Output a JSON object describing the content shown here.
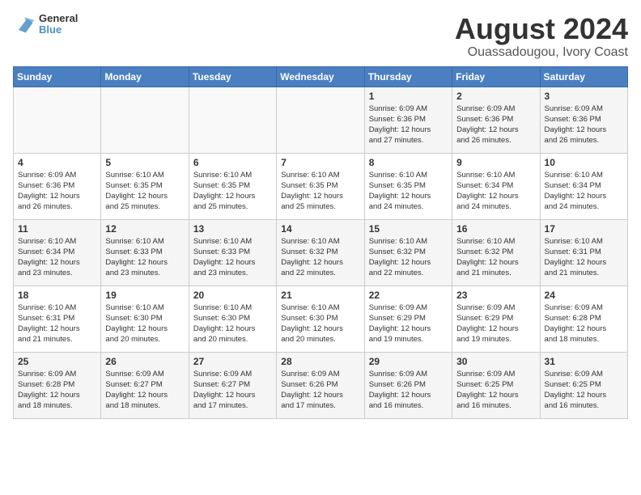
{
  "header": {
    "logo_line1": "General",
    "logo_line2": "Blue",
    "month_title": "August 2024",
    "subtitle": "Ouassadougou, Ivory Coast"
  },
  "weekdays": [
    "Sunday",
    "Monday",
    "Tuesday",
    "Wednesday",
    "Thursday",
    "Friday",
    "Saturday"
  ],
  "weeks": [
    [
      {
        "day": "",
        "text": ""
      },
      {
        "day": "",
        "text": ""
      },
      {
        "day": "",
        "text": ""
      },
      {
        "day": "",
        "text": ""
      },
      {
        "day": "1",
        "text": "Sunrise: 6:09 AM\nSunset: 6:36 PM\nDaylight: 12 hours\nand 27 minutes."
      },
      {
        "day": "2",
        "text": "Sunrise: 6:09 AM\nSunset: 6:36 PM\nDaylight: 12 hours\nand 26 minutes."
      },
      {
        "day": "3",
        "text": "Sunrise: 6:09 AM\nSunset: 6:36 PM\nDaylight: 12 hours\nand 26 minutes."
      }
    ],
    [
      {
        "day": "4",
        "text": "Sunrise: 6:09 AM\nSunset: 6:36 PM\nDaylight: 12 hours\nand 26 minutes."
      },
      {
        "day": "5",
        "text": "Sunrise: 6:10 AM\nSunset: 6:35 PM\nDaylight: 12 hours\nand 25 minutes."
      },
      {
        "day": "6",
        "text": "Sunrise: 6:10 AM\nSunset: 6:35 PM\nDaylight: 12 hours\nand 25 minutes."
      },
      {
        "day": "7",
        "text": "Sunrise: 6:10 AM\nSunset: 6:35 PM\nDaylight: 12 hours\nand 25 minutes."
      },
      {
        "day": "8",
        "text": "Sunrise: 6:10 AM\nSunset: 6:35 PM\nDaylight: 12 hours\nand 24 minutes."
      },
      {
        "day": "9",
        "text": "Sunrise: 6:10 AM\nSunset: 6:34 PM\nDaylight: 12 hours\nand 24 minutes."
      },
      {
        "day": "10",
        "text": "Sunrise: 6:10 AM\nSunset: 6:34 PM\nDaylight: 12 hours\nand 24 minutes."
      }
    ],
    [
      {
        "day": "11",
        "text": "Sunrise: 6:10 AM\nSunset: 6:34 PM\nDaylight: 12 hours\nand 23 minutes."
      },
      {
        "day": "12",
        "text": "Sunrise: 6:10 AM\nSunset: 6:33 PM\nDaylight: 12 hours\nand 23 minutes."
      },
      {
        "day": "13",
        "text": "Sunrise: 6:10 AM\nSunset: 6:33 PM\nDaylight: 12 hours\nand 23 minutes."
      },
      {
        "day": "14",
        "text": "Sunrise: 6:10 AM\nSunset: 6:32 PM\nDaylight: 12 hours\nand 22 minutes."
      },
      {
        "day": "15",
        "text": "Sunrise: 6:10 AM\nSunset: 6:32 PM\nDaylight: 12 hours\nand 22 minutes."
      },
      {
        "day": "16",
        "text": "Sunrise: 6:10 AM\nSunset: 6:32 PM\nDaylight: 12 hours\nand 21 minutes."
      },
      {
        "day": "17",
        "text": "Sunrise: 6:10 AM\nSunset: 6:31 PM\nDaylight: 12 hours\nand 21 minutes."
      }
    ],
    [
      {
        "day": "18",
        "text": "Sunrise: 6:10 AM\nSunset: 6:31 PM\nDaylight: 12 hours\nand 21 minutes."
      },
      {
        "day": "19",
        "text": "Sunrise: 6:10 AM\nSunset: 6:30 PM\nDaylight: 12 hours\nand 20 minutes."
      },
      {
        "day": "20",
        "text": "Sunrise: 6:10 AM\nSunset: 6:30 PM\nDaylight: 12 hours\nand 20 minutes."
      },
      {
        "day": "21",
        "text": "Sunrise: 6:10 AM\nSunset: 6:30 PM\nDaylight: 12 hours\nand 20 minutes."
      },
      {
        "day": "22",
        "text": "Sunrise: 6:09 AM\nSunset: 6:29 PM\nDaylight: 12 hours\nand 19 minutes."
      },
      {
        "day": "23",
        "text": "Sunrise: 6:09 AM\nSunset: 6:29 PM\nDaylight: 12 hours\nand 19 minutes."
      },
      {
        "day": "24",
        "text": "Sunrise: 6:09 AM\nSunset: 6:28 PM\nDaylight: 12 hours\nand 18 minutes."
      }
    ],
    [
      {
        "day": "25",
        "text": "Sunrise: 6:09 AM\nSunset: 6:28 PM\nDaylight: 12 hours\nand 18 minutes."
      },
      {
        "day": "26",
        "text": "Sunrise: 6:09 AM\nSunset: 6:27 PM\nDaylight: 12 hours\nand 18 minutes."
      },
      {
        "day": "27",
        "text": "Sunrise: 6:09 AM\nSunset: 6:27 PM\nDaylight: 12 hours\nand 17 minutes."
      },
      {
        "day": "28",
        "text": "Sunrise: 6:09 AM\nSunset: 6:26 PM\nDaylight: 12 hours\nand 17 minutes."
      },
      {
        "day": "29",
        "text": "Sunrise: 6:09 AM\nSunset: 6:26 PM\nDaylight: 12 hours\nand 16 minutes."
      },
      {
        "day": "30",
        "text": "Sunrise: 6:09 AM\nSunset: 6:25 PM\nDaylight: 12 hours\nand 16 minutes."
      },
      {
        "day": "31",
        "text": "Sunrise: 6:09 AM\nSunset: 6:25 PM\nDaylight: 12 hours\nand 16 minutes."
      }
    ]
  ]
}
